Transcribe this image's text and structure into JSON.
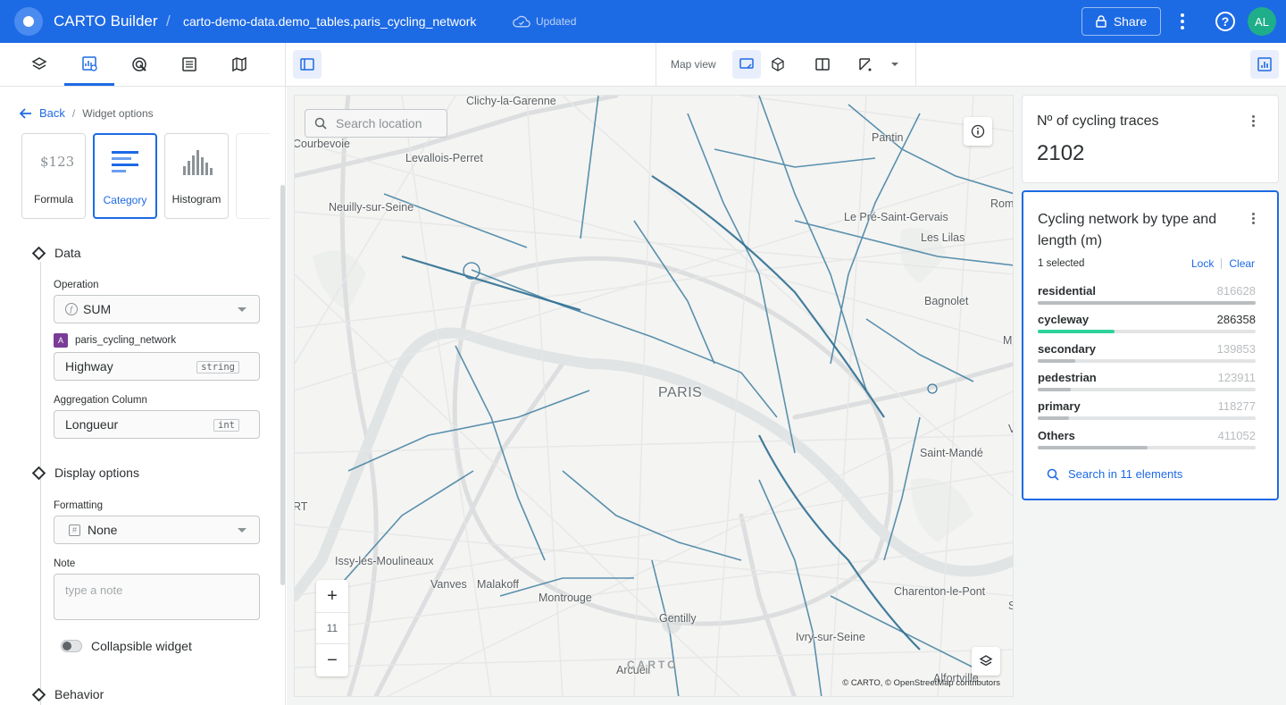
{
  "header": {
    "app_title": "CARTO Builder",
    "separator": "/",
    "map_name": "carto-demo-data.demo_tables.paris_cycling_network",
    "status": "Updated",
    "share_label": "Share",
    "avatar_initials": "AL",
    "brand_color": "#1d6ae5"
  },
  "toolbar": {
    "map_view_label": "Map view"
  },
  "left_panel": {
    "back_label": "Back",
    "crumb_sep": "/",
    "crumb_current": "Widget options",
    "widget_types": [
      {
        "label": "Formula",
        "icon": "formula-icon",
        "active": false
      },
      {
        "label": "Category",
        "icon": "category-icon",
        "active": true
      },
      {
        "label": "Histogram",
        "icon": "histogram-icon",
        "active": false
      }
    ],
    "formula_icon_text": "$123",
    "data_section": "Data",
    "operation_label": "Operation",
    "operation_icon": "ƒ",
    "operation_value": "SUM",
    "source_badge": "A",
    "source_name": "paris_cycling_network",
    "column_value": "Highway",
    "column_type": "string",
    "aggregation_label": "Aggregation Column",
    "aggregation_value": "Longueur",
    "aggregation_type": "int",
    "display_section": "Display options",
    "formatting_label": "Formatting",
    "formatting_icon": "#",
    "formatting_value": "None",
    "note_label": "Note",
    "note_placeholder": "type a note",
    "collapsible_label": "Collapsible widget",
    "behavior_section": "Behavior"
  },
  "map": {
    "search_placeholder": "Search location",
    "zoom_in": "+",
    "zoom_level": "11",
    "zoom_out": "−",
    "attribution": "© CARTO, © OpenStreetMap contributors",
    "carto_mark": "CARTO",
    "places": {
      "clichy": "Clichy-la-Garenne",
      "courbevoie": "Courbevoie",
      "levallois": "Levallois-Perret",
      "pantin": "Pantin",
      "neuilly": "Neuilly-sur-Seine",
      "prestgervais": "Le Pré-Saint-Gervais",
      "rom": "Rom",
      "lilas": "Les Lilas",
      "bagnolet": "Bagnolet",
      "m": "M",
      "paris": "PARIS",
      "v": "V",
      "saintmande": "Saint-Mandé",
      "rt": "RT",
      "issy": "Issy-les-Moulineaux",
      "vanves": "Vanves",
      "malakoff": "Malakoff",
      "montrouge": "Montrouge",
      "charenton": "Charenton-le-Pont",
      "s": "S",
      "gentilly": "Gentilly",
      "ivry": "Ivry-sur-Seine",
      "arcueil": "Arcueil",
      "alfortville": "Alfortville"
    }
  },
  "widgets": {
    "count": {
      "title": "Nº of cycling traces",
      "value": "2102"
    },
    "category": {
      "title": "Cycling network by type and length (m)",
      "selected_text": "1 selected",
      "lock_label": "Lock",
      "clear_label": "Clear",
      "search_label": "Search in 11 elements",
      "selected_color": "#2fd39a"
    }
  },
  "chart_data": {
    "type": "bar",
    "title": "Cycling network by type and length (m)",
    "categories": [
      "residential",
      "cycleway",
      "secondary",
      "pedestrian",
      "primary",
      "Others"
    ],
    "values": [
      816628,
      286358,
      139853,
      123911,
      118277,
      411052
    ],
    "value_labels": [
      "816628",
      "286358",
      "139853",
      "123911",
      "118277",
      "411052"
    ],
    "selected": "cycleway",
    "max": 816628
  }
}
